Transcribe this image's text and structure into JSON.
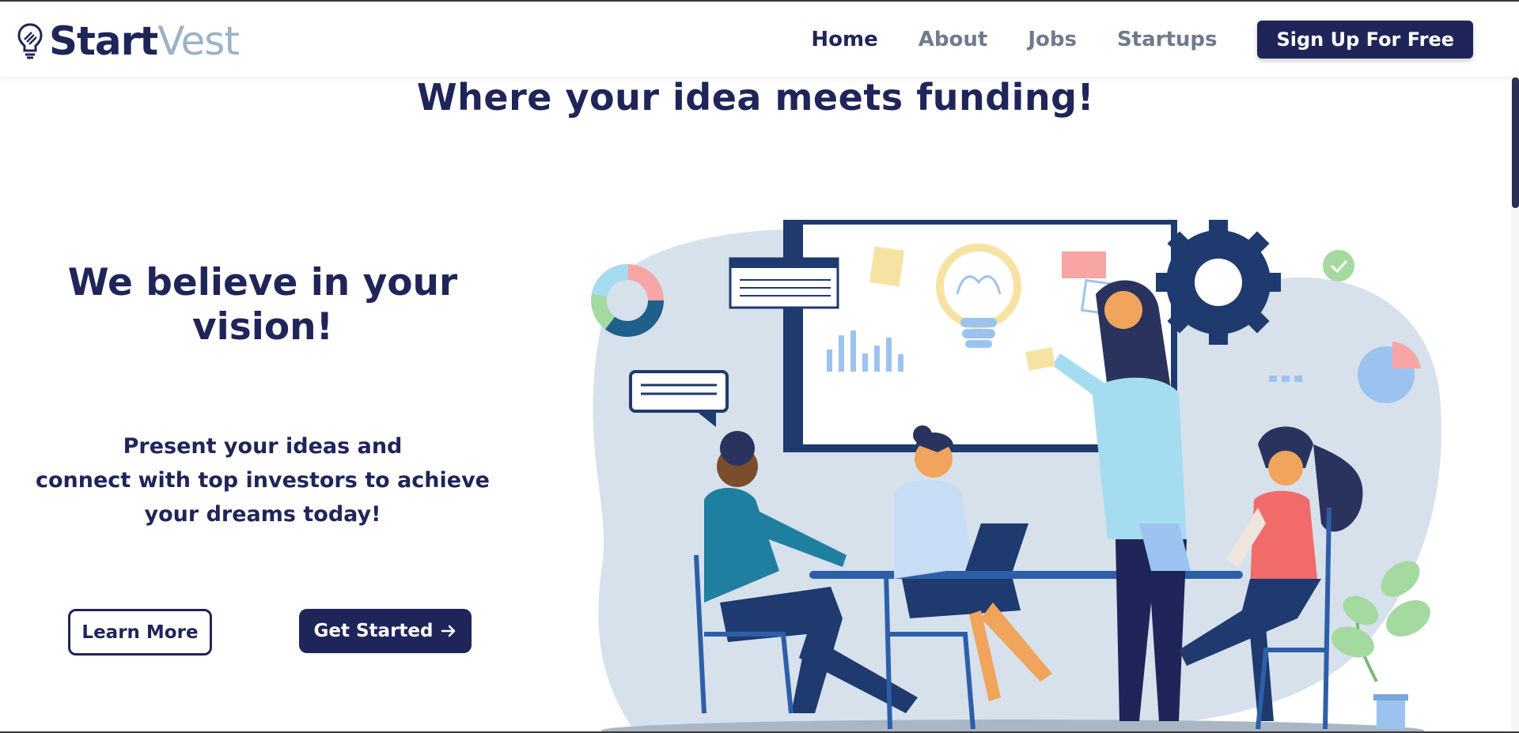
{
  "brand": {
    "name_start": "Start",
    "name_vest": "Vest"
  },
  "nav": {
    "links": [
      "Home",
      "About",
      "Jobs",
      "Startups"
    ],
    "active": "Home",
    "signup_label": "Sign Up For Free"
  },
  "page": {
    "title": "Where your idea meets funding!"
  },
  "hero": {
    "heading": "We believe in your vision!",
    "sub_lines": [
      "Present your ideas and",
      "connect with top investors to achieve",
      "your dreams today!"
    ],
    "learn_more_label": "Learn More",
    "get_started_label": "Get Started"
  },
  "colors": {
    "primary": "#1f2559",
    "nav_inactive": "#6f7a8d",
    "logo_accent": "#9bb3c4",
    "blob": "#d6e1ec"
  },
  "icons": [
    "lightbulb-logo-icon",
    "arrow-right-icon",
    "gear-icon",
    "check-circle-icon",
    "donut-chart-icon",
    "pie-chart-icon"
  ]
}
